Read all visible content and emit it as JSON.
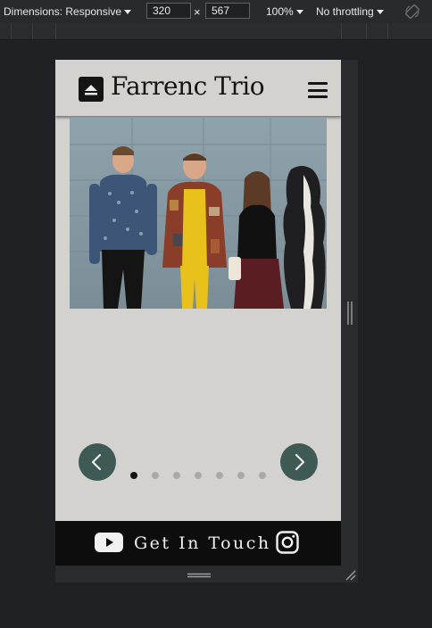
{
  "devtools": {
    "dimensions_label": "Dimensions: Responsive",
    "width_value": "320",
    "height_value": "567",
    "times_symbol": "×",
    "zoom_label": "100%",
    "throttling_label": "No throttling",
    "rotate_icon": "rotate-icon"
  },
  "site": {
    "title": "Farrenc Trio",
    "logo_icon": "eject-icon",
    "menu_icon": "hamburger-icon"
  },
  "carousel": {
    "slide_count": 7,
    "active_index": 0,
    "prev_icon": "chevron-left-icon",
    "next_icon": "chevron-right-icon"
  },
  "footer": {
    "cta_label": "Get In Touch",
    "youtube_icon": "youtube-icon",
    "instagram_icon": "instagram-icon"
  },
  "colors": {
    "page_bg": "#d3d2cf",
    "nav_button": "#3f5a55",
    "footer_bg": "#0d0d0d"
  }
}
